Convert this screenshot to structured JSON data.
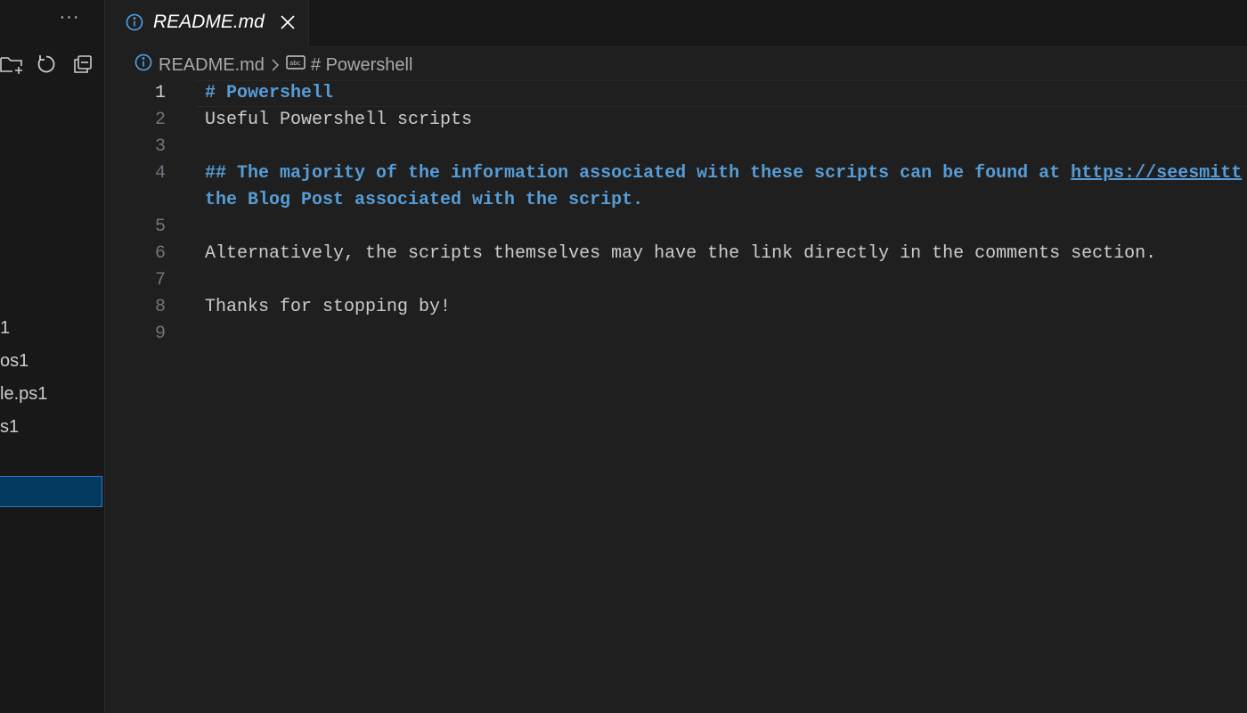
{
  "sidebar": {
    "more_actions": "···",
    "actions": [
      {
        "name": "new-folder-icon"
      },
      {
        "name": "refresh-icon"
      },
      {
        "name": "collapse-all-icon"
      }
    ],
    "files": [
      "1",
      "os1",
      "le.ps1",
      "s1",
      ""
    ]
  },
  "tab": {
    "title": "README.md",
    "icon": "info-icon",
    "close_icon": "close-icon"
  },
  "breadcrumb": {
    "file": "README.md",
    "symbol": "# Powershell"
  },
  "editor": {
    "lines": [
      {
        "number": "1",
        "segments": [
          {
            "text": "# Powershell",
            "style": "heading"
          }
        ]
      },
      {
        "number": "2",
        "segments": [
          {
            "text": "Useful Powershell scripts",
            "style": "plain"
          }
        ]
      },
      {
        "number": "3",
        "segments": []
      },
      {
        "number": "4",
        "segments": [
          {
            "text": "## The majority of the information associated with these scripts can be found at ",
            "style": "heading"
          },
          {
            "text": "https://seesmitt",
            "style": "link"
          }
        ]
      },
      {
        "number": "",
        "segments": [
          {
            "text": "the Blog Post associated with the script.",
            "style": "heading"
          }
        ]
      },
      {
        "number": "5",
        "segments": []
      },
      {
        "number": "6",
        "segments": [
          {
            "text": "Alternatively, the scripts themselves may have the link directly in the comments section.",
            "style": "plain"
          }
        ]
      },
      {
        "number": "7",
        "segments": []
      },
      {
        "number": "8",
        "segments": [
          {
            "text": "Thanks for stopping by!",
            "style": "plain"
          }
        ]
      },
      {
        "number": "9",
        "segments": []
      }
    ],
    "active_line": "1"
  },
  "colors": {
    "background": "#1f1f1f",
    "sidebar": "#181818",
    "heading": "#569cd6",
    "text": "#cccccc",
    "line_number": "#6e7681",
    "selection": "#04395e",
    "selection_border": "#2b79d2"
  }
}
